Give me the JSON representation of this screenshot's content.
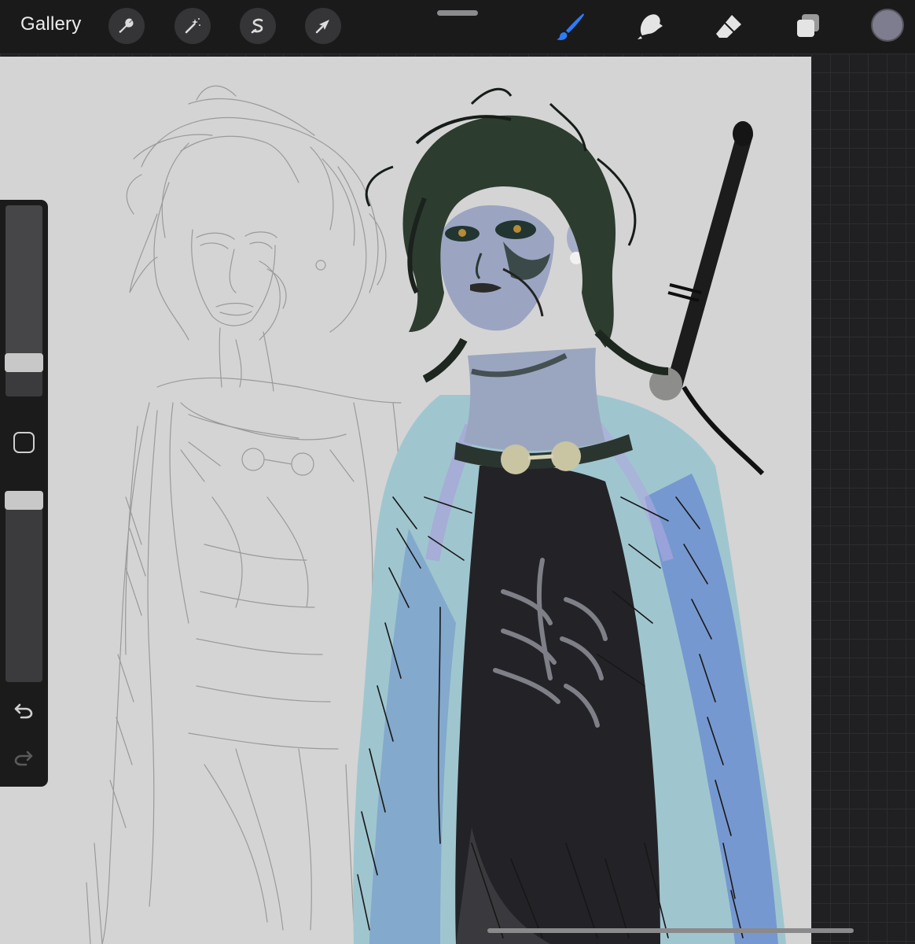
{
  "toolbar": {
    "gallery_label": "Gallery",
    "left_tools": [
      "wrench-icon",
      "magic-wand-icon",
      "selection-icon",
      "move-arrow-icon"
    ],
    "right_tools": [
      "brush-icon",
      "smudge-icon",
      "eraser-icon",
      "layers-icon"
    ],
    "active_tool": "brush-icon",
    "active_color": "#7e7c8f",
    "accent_color": "#2d7cf6"
  },
  "sidebar": {
    "brush_size_level": 0.14,
    "opacity_level": 1.0,
    "controls": [
      "brush-size-slider",
      "modify-button",
      "opacity-slider",
      "undo-button",
      "redo-button"
    ]
  }
}
